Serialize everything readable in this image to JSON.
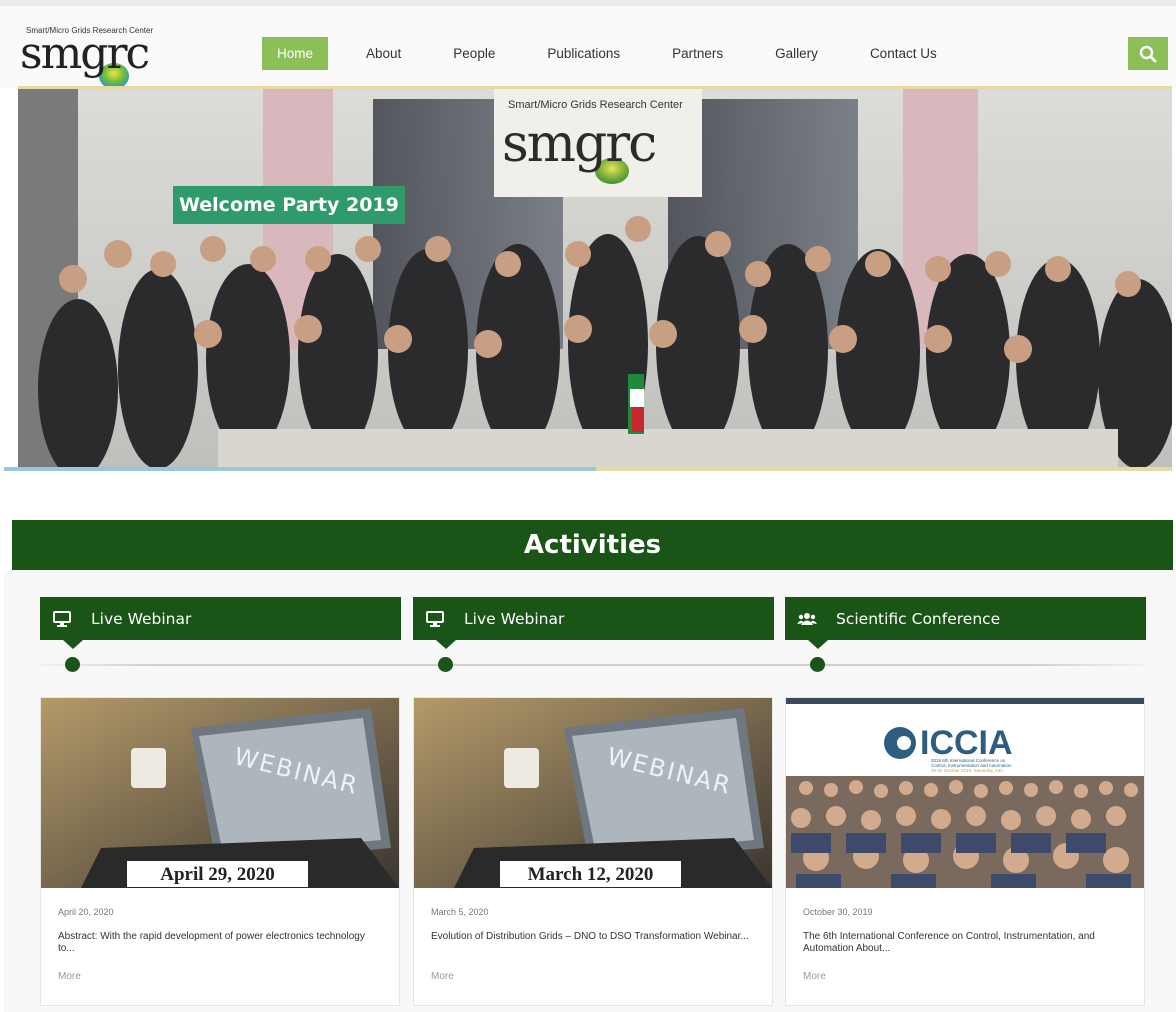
{
  "brand": {
    "logo_small_text": "Smart/Micro Grids Research Center",
    "logo_main_text": "smgrc"
  },
  "nav": {
    "items": [
      {
        "label": "Home"
      },
      {
        "label": "About"
      },
      {
        "label": "People"
      },
      {
        "label": "Publications"
      },
      {
        "label": "Partners"
      },
      {
        "label": "Gallery"
      },
      {
        "label": "Contact Us"
      }
    ],
    "active": "Home",
    "search_icon": "search-icon"
  },
  "hero": {
    "sign_text": "Smart/Micro Grids Research Center",
    "sign_logo": "smgrc",
    "caption": "Welcome Party 2019"
  },
  "activities": {
    "title": "Activities",
    "tabs": [
      {
        "icon": "monitor-icon",
        "label": "Live Webinar"
      },
      {
        "icon": "monitor-icon",
        "label": "Live Webinar"
      },
      {
        "icon": "users-icon",
        "label": "Scientific Conference"
      }
    ],
    "cards": [
      {
        "image_label": "April 29, 2020",
        "image_word": "WEBINAR",
        "date": "April 20, 2020",
        "text": "Abstract: With the rapid development of power electronics technology to...",
        "more": "More"
      },
      {
        "image_label": "March 12, 2020",
        "image_word": "WEBINAR",
        "date": "March 5, 2020",
        "text": "Evolution of Distribution Grids – DNO to DSO Transformation Webinar...",
        "more": "More"
      },
      {
        "image_title": "ICCIA",
        "image_sub1": "2019 6th International Conference on",
        "image_sub2": "Control, Instrumentation and Automation",
        "image_sub3": "30-31 October 2019, Sanandaj, Iran",
        "date": "October 30, 2019",
        "text": "The 6th International Conference on Control, Instrumentation, and Automation About...",
        "more": "More"
      }
    ]
  },
  "colors": {
    "accent_green": "#8dbf59",
    "dark_green": "#1a5417",
    "caption_green": "#2f9a6b"
  }
}
